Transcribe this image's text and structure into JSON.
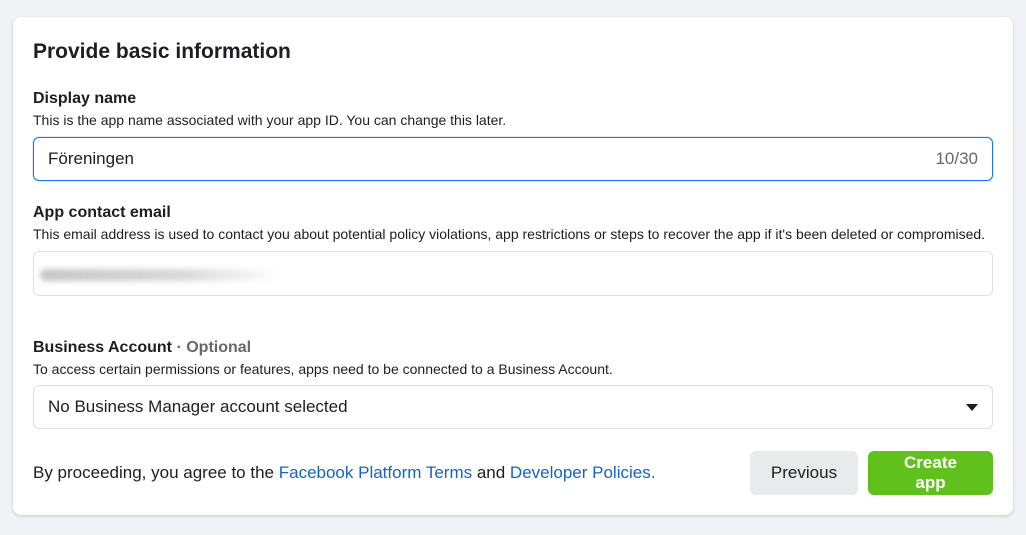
{
  "section": {
    "title": "Provide basic information"
  },
  "display_name": {
    "label": "Display name",
    "help": "This is the app name associated with your app ID. You can change this later.",
    "value": "Föreningen",
    "counter": "10/30"
  },
  "contact_email": {
    "label": "App contact email",
    "help": "This email address is used to contact you about potential policy violations, app restrictions or steps to recover the app if it's been deleted or compromised."
  },
  "business_account": {
    "label": "Business Account",
    "separator": "·",
    "optional": "Optional",
    "help": "To access certain permissions or features, apps need to be connected to a Business Account.",
    "selected": "No Business Manager account selected"
  },
  "footer": {
    "agree_prefix": "By proceeding, you agree to the ",
    "platform_terms": "Facebook Platform Terms",
    "and": " and ",
    "developer_policies": "Developer Policies.",
    "previous_label": "Previous",
    "create_label": "Create app"
  },
  "colors": {
    "primary_link": "#1565c0",
    "create_button": "#61c11c",
    "focus_border": "#1877f2"
  },
  "icons": {
    "dropdown": "caret-down-icon"
  }
}
